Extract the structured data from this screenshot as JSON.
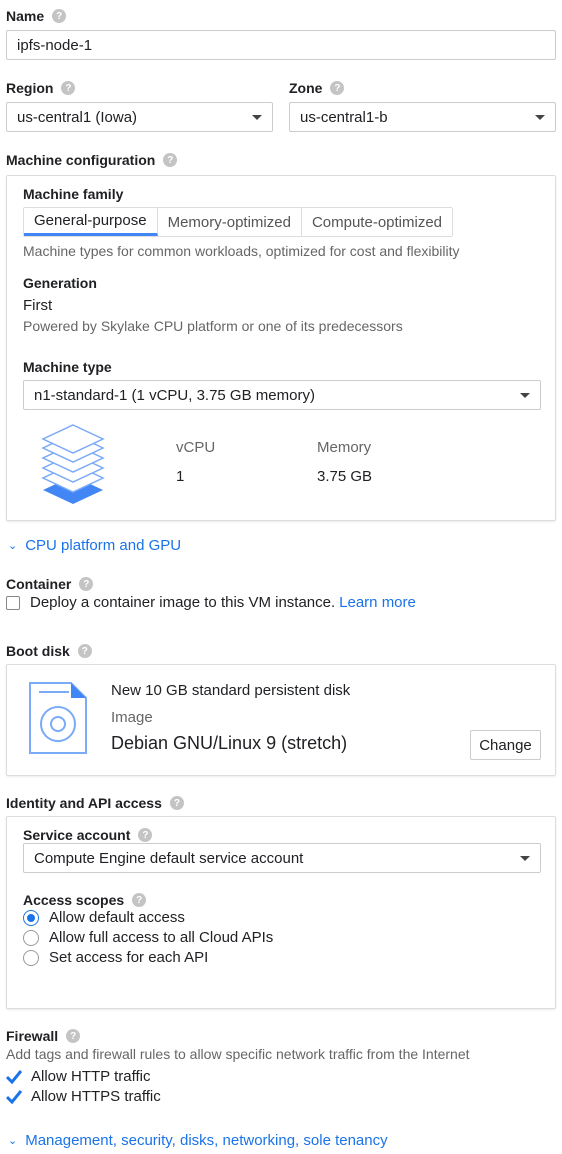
{
  "name": {
    "label": "Name",
    "value": "ipfs-node-1"
  },
  "region": {
    "label": "Region",
    "value": "us-central1 (Iowa)"
  },
  "zone": {
    "label": "Zone",
    "value": "us-central1-b"
  },
  "machine_config": {
    "label": "Machine configuration",
    "family_label": "Machine family",
    "tabs": [
      {
        "label": "General-purpose",
        "active": true
      },
      {
        "label": "Memory-optimized"
      },
      {
        "label": "Compute-optimized"
      }
    ],
    "family_desc": "Machine types for common workloads, optimized for cost and flexibility",
    "generation_label": "Generation",
    "generation_value": "First",
    "generation_desc": "Powered by Skylake CPU platform or one of its predecessors",
    "type_label": "Machine type",
    "type_value": "n1-standard-1 (1 vCPU, 3.75 GB memory)",
    "vcpu_label": "vCPU",
    "vcpu_value": "1",
    "memory_label": "Memory",
    "memory_value": "3.75 GB"
  },
  "cpu_platform_link": "CPU platform and GPU",
  "container": {
    "label": "Container",
    "checkbox_label": "Deploy a container image to this VM instance.",
    "learn_more": "Learn more",
    "checked": false
  },
  "boot_disk": {
    "label": "Boot disk",
    "title": "New 10 GB standard persistent disk",
    "image_label": "Image",
    "image_value": "Debian GNU/Linux 9 (stretch)",
    "change_button": "Change"
  },
  "identity": {
    "label": "Identity and API access",
    "service_account_label": "Service account",
    "service_account_value": "Compute Engine default service account",
    "scopes_label": "Access scopes",
    "scopes": [
      {
        "label": "Allow default access",
        "selected": true
      },
      {
        "label": "Allow full access to all Cloud APIs"
      },
      {
        "label": "Set access for each API"
      }
    ]
  },
  "firewall": {
    "label": "Firewall",
    "desc": "Add tags and firewall rules to allow specific network traffic from the Internet",
    "http": {
      "label": "Allow HTTP traffic",
      "checked": true
    },
    "https": {
      "label": "Allow HTTPS traffic",
      "checked": true
    }
  },
  "management_link": "Management, security, disks, networking, sole tenancy",
  "colors": {
    "accent": "#1a73e8",
    "tab_underline": "#4285f4"
  }
}
